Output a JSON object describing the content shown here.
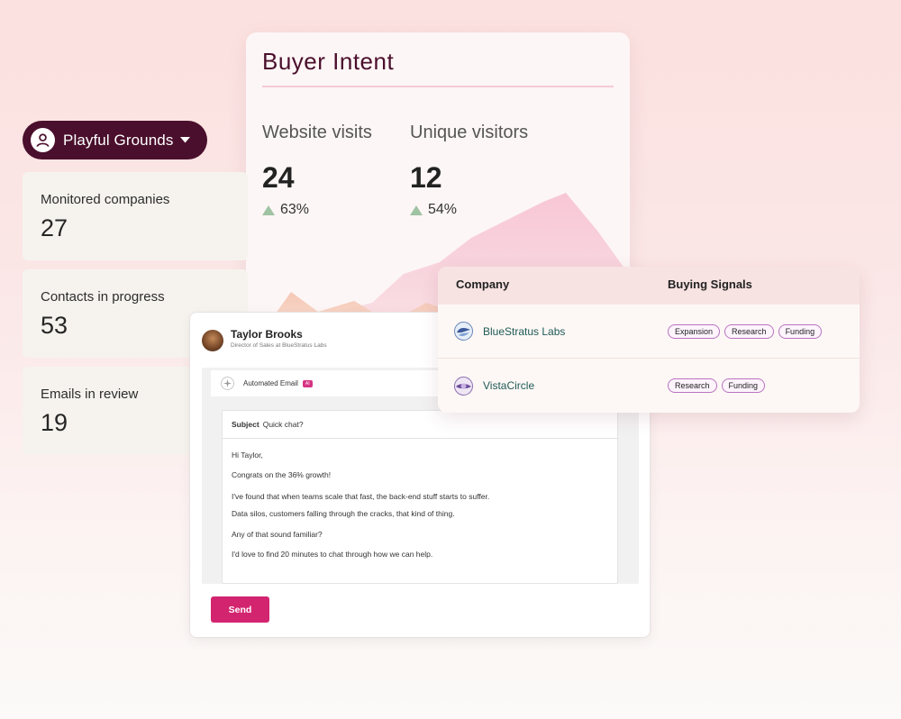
{
  "account": {
    "name": "Playful Grounds",
    "icon": "user-circle-icon"
  },
  "stats": [
    {
      "label": "Monitored companies",
      "value": "27"
    },
    {
      "label": "Contacts in progress",
      "value": "53"
    },
    {
      "label": "Emails in review",
      "value": "19"
    }
  ],
  "buyer_intent": {
    "title": "Buyer Intent",
    "metrics": [
      {
        "label": "Website visits",
        "value": "24",
        "change": "63%"
      },
      {
        "label": "Unique visitors",
        "value": "12",
        "change": "54%"
      }
    ]
  },
  "email": {
    "sender_name": "Taylor Brooks",
    "sender_role": "Director of Sales at BlueStratus Labs",
    "type_label": "Automated Email",
    "ai_badge": "AI",
    "subject_key": "Subject",
    "subject": "Quick chat?",
    "body_lines": [
      "Hi Taylor,",
      "Congrats on the 36% growth!",
      "I've found that when teams scale that fast, the back-end stuff starts to suffer.",
      "Data silos, customers falling through the cracks, that kind of thing.",
      "Any of that sound familiar?",
      "I'd love to find 20 minutes to chat through how we can help."
    ],
    "send_label": "Send"
  },
  "companies": {
    "headers": {
      "company": "Company",
      "signals": "Buying Signals"
    },
    "rows": [
      {
        "name": "BlueStratus Labs",
        "tags": [
          "Expansion",
          "Research",
          "Funding"
        ]
      },
      {
        "name": "VistaCircle",
        "tags": [
          "Research",
          "Funding"
        ]
      }
    ]
  },
  "colors": {
    "brand_dark": "#4a0f2c",
    "accent_pink": "#d3246f",
    "tag_border": "#b873c0",
    "trend_up": "#9fc3a3"
  }
}
